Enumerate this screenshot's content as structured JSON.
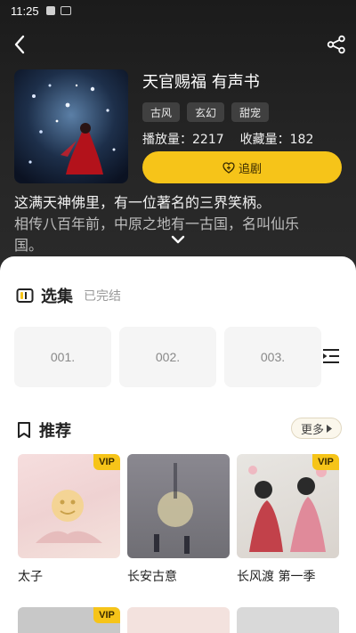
{
  "status_bar": {
    "time": "11:25"
  },
  "book": {
    "title": "天官赐福 有声书",
    "tags": [
      "古风",
      "玄幻",
      "甜宠"
    ],
    "play_count_label": "播放量：2217",
    "favorite_count_label": "收藏量：182",
    "follow_label": "追剧",
    "description_lines": [
      "这满天神佛里，有一位著名的三界笑柄。",
      "相传八百年前，中原之地有一古国，名叫仙乐",
      "国。"
    ]
  },
  "episodes_section": {
    "title": "选集",
    "status": "已完结",
    "episodes": [
      "001.",
      "002.",
      "003."
    ]
  },
  "recommend_section": {
    "title": "推荐",
    "more_label": "更多",
    "items": [
      {
        "title": "太子",
        "badge": "VIP"
      },
      {
        "title": "长安古意",
        "badge": ""
      },
      {
        "title": "长风渡  第一季",
        "badge": "VIP"
      }
    ],
    "row2_badges": [
      "VIP",
      "",
      ""
    ]
  },
  "colors": {
    "accent": "#f6c419",
    "dark_bg": "#1e1e1e",
    "sheet_bg": "#ffffff"
  }
}
